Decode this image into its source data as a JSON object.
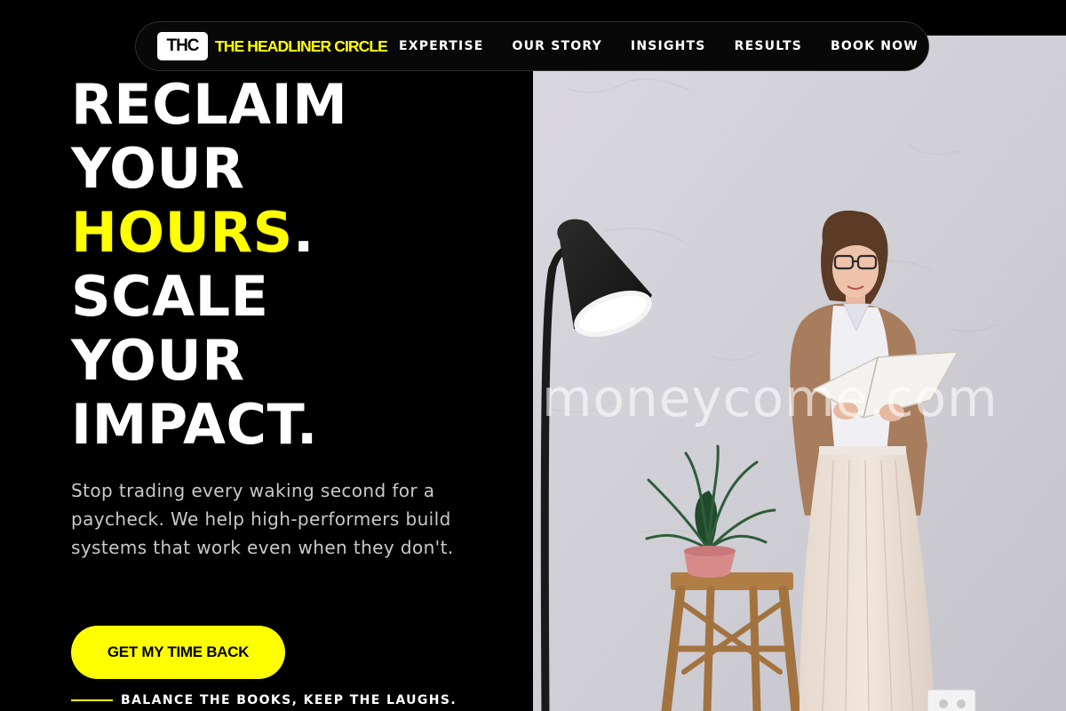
{
  "brand": {
    "badge": "THC",
    "name": "THE HEADLINER CIRCLE"
  },
  "nav": {
    "links": [
      "EXPERTISE",
      "OUR STORY",
      "INSIGHTS",
      "RESULTS",
      "BOOK NOW"
    ]
  },
  "hero": {
    "headline": {
      "line1": "RECLAIM",
      "line2": "YOUR",
      "line3_accent": "HOURS",
      "line3_period": ".",
      "line4": "SCALE",
      "line5": "YOUR",
      "line6": "IMPACT."
    },
    "subtext": "Stop trading every waking second for a paycheck. We help high-performers build systems that work even when they don't.",
    "cta_label": "GET MY TIME BACK",
    "tagline": "BALANCE THE BOOKS, KEEP THE LAUGHS."
  },
  "image": {
    "watermark": "moneycome.com"
  },
  "colors": {
    "accent": "#ffff00",
    "background": "#000000",
    "text": "#ffffff",
    "subtext": "#c9c9c9"
  }
}
